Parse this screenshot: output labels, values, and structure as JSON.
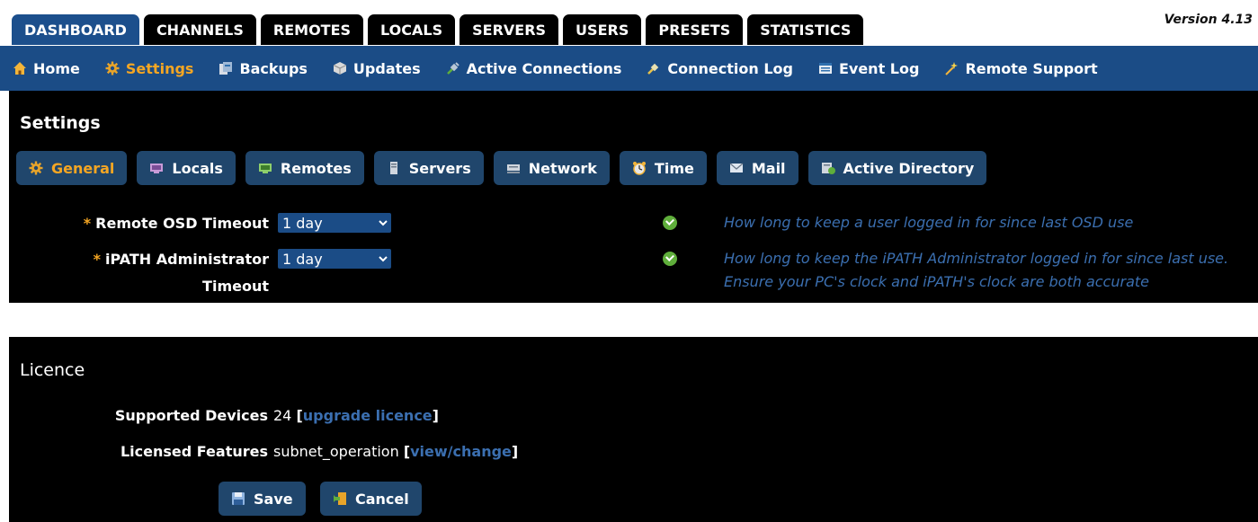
{
  "version": "Version 4.13",
  "tabs": [
    {
      "label": "DASHBOARD",
      "active": true
    },
    {
      "label": "CHANNELS"
    },
    {
      "label": "REMOTES"
    },
    {
      "label": "LOCALS"
    },
    {
      "label": "SERVERS"
    },
    {
      "label": "USERS"
    },
    {
      "label": "PRESETS"
    },
    {
      "label": "STATISTICS"
    }
  ],
  "subnav": [
    {
      "label": "Home",
      "icon": "home-icon"
    },
    {
      "label": "Settings",
      "icon": "gear-icon",
      "active": true
    },
    {
      "label": "Backups",
      "icon": "backups-icon"
    },
    {
      "label": "Updates",
      "icon": "updates-icon"
    },
    {
      "label": "Active Connections",
      "icon": "plug-icon"
    },
    {
      "label": "Connection Log",
      "icon": "plug-log-icon"
    },
    {
      "label": "Event Log",
      "icon": "list-icon"
    },
    {
      "label": "Remote Support",
      "icon": "wand-icon"
    }
  ],
  "settings": {
    "title": "Settings",
    "subtabs": [
      {
        "label": "General",
        "icon": "gear-icon",
        "active": true
      },
      {
        "label": "Locals",
        "icon": "local-computer-icon"
      },
      {
        "label": "Remotes",
        "icon": "remote-computer-icon"
      },
      {
        "label": "Servers",
        "icon": "server-icon"
      },
      {
        "label": "Network",
        "icon": "network-icon"
      },
      {
        "label": "Time",
        "icon": "clock-icon"
      },
      {
        "label": "Mail",
        "icon": "mail-icon"
      },
      {
        "label": "Active Directory",
        "icon": "directory-icon"
      }
    ],
    "fields": [
      {
        "required": "*",
        "label_line1": "Remote OSD Timeout",
        "label_line2": "",
        "value": "1 day",
        "help": "How long to keep a user logged in for since last OSD use"
      },
      {
        "required": "*",
        "label_line1": "iPATH Administrator",
        "label_line2": "Timeout",
        "value": "1 day",
        "help": "How long to keep the iPATH Administrator logged in for since last use. Ensure your PC's clock and iPATH's clock are both accurate"
      }
    ]
  },
  "licence": {
    "title": "Licence",
    "supported_label": "Supported Devices",
    "supported_value": "24",
    "upgrade_link": "upgrade licence",
    "features_label": "Licensed Features",
    "features_value": "subnet_operation",
    "view_link": "view/change",
    "bracket_open": "[",
    "bracket_close": "]"
  },
  "actions": {
    "save": "Save",
    "cancel": "Cancel"
  },
  "colors": {
    "nav_blue": "#1b4c86",
    "button_blue": "#20466c",
    "accent_orange": "#f5a623",
    "help_blue": "#3b6fb0",
    "ok_green": "#5fae3b"
  }
}
